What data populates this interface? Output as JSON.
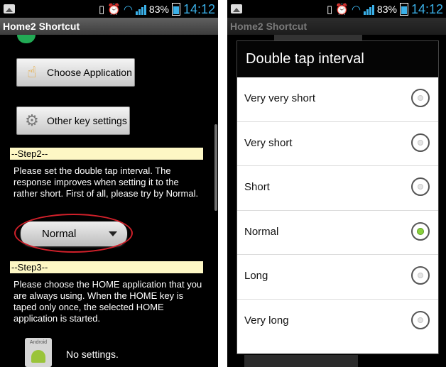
{
  "status_bar": {
    "battery_pct": "83%",
    "time": "14:12",
    "icons": [
      "picture-icon",
      "phone-vibrate-icon",
      "alarm-icon",
      "wifi-icon",
      "signal-icon",
      "battery-icon"
    ]
  },
  "left": {
    "app_title": "Home2 Shortcut",
    "choose_app_label": "Choose Application",
    "other_keys_label": "Other key settings",
    "step2_header": "--Step2--",
    "step2_text": "Please set the double tap interval. The response improves when setting it to the rather short. First of all, please try by Normal.",
    "interval_value": "Normal",
    "step3_header": "--Step3--",
    "step3_text": "Please choose the HOME application that you are always using. When the HOME key is taped only once, the selected HOME application is started.",
    "app_icon_label": "Android",
    "no_settings": "No settings."
  },
  "right": {
    "app_title": "Home2 Shortcut",
    "dialog_title": "Double tap interval",
    "options": [
      {
        "label": "Very very short",
        "checked": false
      },
      {
        "label": "Very short",
        "checked": false
      },
      {
        "label": "Short",
        "checked": false
      },
      {
        "label": "Normal",
        "checked": true
      },
      {
        "label": "Long",
        "checked": false
      },
      {
        "label": "Very long",
        "checked": false
      }
    ]
  },
  "colors": {
    "accent_blue": "#3ab0e8",
    "step_bg": "#fdf7c4",
    "highlight_red": "#d0202a",
    "radio_selected": "#8ad13c"
  }
}
